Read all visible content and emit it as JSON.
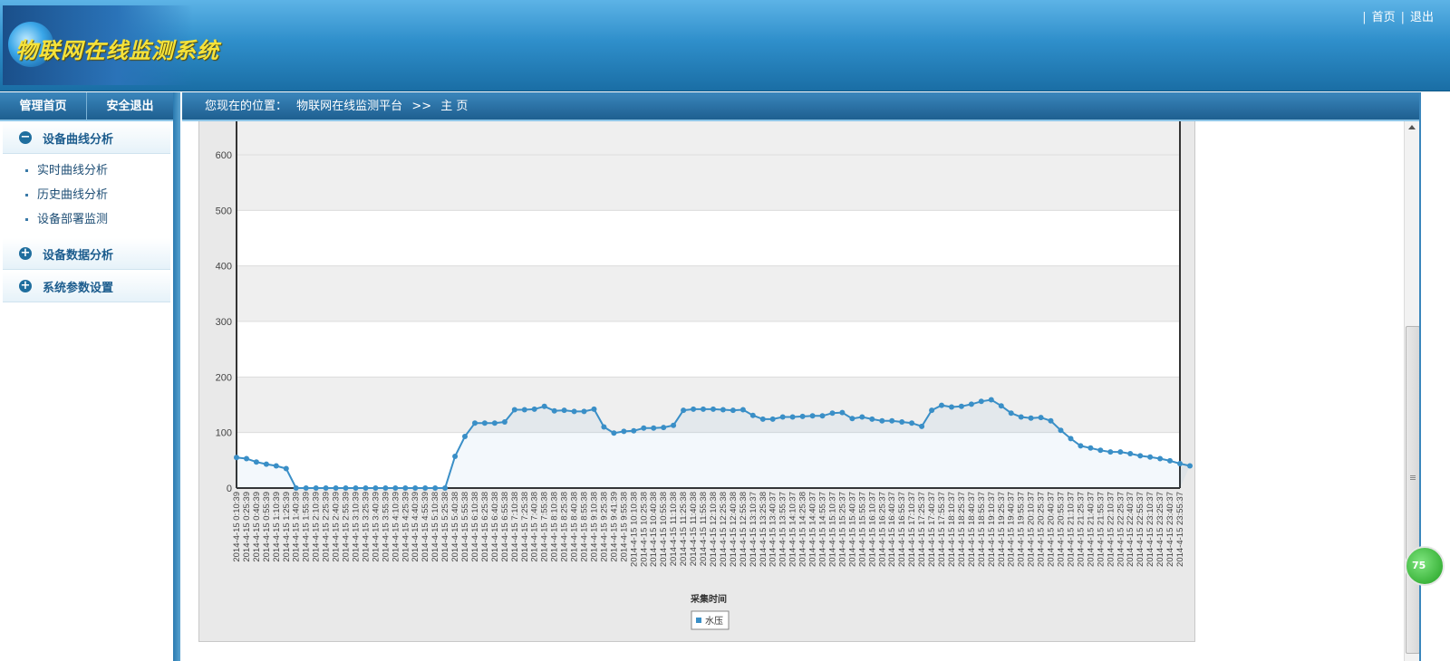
{
  "header": {
    "logo_text": "物联网在线监测系统",
    "links": [
      "首页",
      "退出"
    ]
  },
  "sidebar": {
    "tabs": [
      "管理首页",
      "安全退出"
    ],
    "groups": [
      {
        "label": "设备曲线分析",
        "icon": "minus-circle-icon",
        "expanded": true,
        "items": [
          "实时曲线分析",
          "历史曲线分析",
          "设备部署监测"
        ]
      },
      {
        "label": "设备数据分析",
        "icon": "plus-circle-icon",
        "expanded": false
      },
      {
        "label": "系统参数设置",
        "icon": "plus-circle-icon",
        "expanded": false
      }
    ]
  },
  "breadcrumb": {
    "prefix": "您现在的位置：",
    "path": [
      "物联网在线监测平台",
      ">>",
      "主 页"
    ]
  },
  "badge": {
    "text": "75"
  },
  "colors": {
    "accent": "#1f6e9e",
    "series": "#3a8fc7",
    "logo_text": "#f5e23a"
  },
  "chart_data": {
    "type": "line",
    "title": "",
    "xlabel": "采集时间",
    "ylabel": "",
    "ylim": [
      0,
      600
    ],
    "yticks": [
      0,
      100,
      200,
      300,
      400,
      500,
      600
    ],
    "grid": true,
    "legend_position": "bottom-center",
    "x": [
      "2014-4-15 0:10:39",
      "2014-4-15 0:25:39",
      "2014-4-15 0:40:39",
      "2014-4-15 0:55:39",
      "2014-4-15 1:10:39",
      "2014-4-15 1:25:39",
      "2014-4-15 1:40:39",
      "2014-4-15 1:55:39",
      "2014-4-15 2:10:39",
      "2014-4-15 2:25:39",
      "2014-4-15 2:40:39",
      "2014-4-15 2:55:39",
      "2014-4-15 3:10:39",
      "2014-4-15 3:25:39",
      "2014-4-15 3:40:39",
      "2014-4-15 3:55:39",
      "2014-4-15 4:10:39",
      "2014-4-15 4:25:39",
      "2014-4-15 4:40:39",
      "2014-4-15 4:55:39",
      "2014-4-15 5:10:38",
      "2014-4-15 5:25:38",
      "2014-4-15 5:40:38",
      "2014-4-15 5:55:38",
      "2014-4-15 6:10:38",
      "2014-4-15 6:25:38",
      "2014-4-15 6:40:38",
      "2014-4-15 6:55:38",
      "2014-4-15 7:10:38",
      "2014-4-15 7:25:38",
      "2014-4-15 7:40:38",
      "2014-4-15 7:55:38",
      "2014-4-15 8:10:38",
      "2014-4-15 8:25:38",
      "2014-4-15 8:40:38",
      "2014-4-15 8:55:38",
      "2014-4-15 9:10:38",
      "2014-4-15 9:25:38",
      "2014-4-15 9:41:39",
      "2014-4-15 9:55:38",
      "2014-4-15 10:10:38",
      "2014-4-15 10:25:38",
      "2014-4-15 10:40:38",
      "2014-4-15 10:55:38",
      "2014-4-15 11:10:38",
      "2014-4-15 11:25:38",
      "2014-4-15 11:40:38",
      "2014-4-15 11:55:38",
      "2014-4-15 12:10:38",
      "2014-4-15 12:25:38",
      "2014-4-15 12:40:38",
      "2014-4-15 12:55:38",
      "2014-4-15 13:10:37",
      "2014-4-15 13:25:38",
      "2014-4-15 13:40:37",
      "2014-4-15 13:55:37",
      "2014-4-15 14:10:37",
      "2014-4-15 14:25:38",
      "2014-4-15 14:40:37",
      "2014-4-15 14:55:37",
      "2014-4-15 15:10:37",
      "2014-4-15 15:25:37",
      "2014-4-15 15:40:37",
      "2014-4-15 15:55:37",
      "2014-4-15 16:10:37",
      "2014-4-15 16:25:37",
      "2014-4-15 16:40:37",
      "2014-4-15 16:55:37",
      "2014-4-15 17:10:37",
      "2014-4-15 17:25:37",
      "2014-4-15 17:40:37",
      "2014-4-15 17:55:37",
      "2014-4-15 18:10:37",
      "2014-4-15 18:25:37",
      "2014-4-15 18:40:37",
      "2014-4-15 18:55:37",
      "2014-4-15 19:10:37",
      "2014-4-15 19:25:37",
      "2014-4-15 19:40:37",
      "2014-4-15 19:55:37",
      "2014-4-15 20:10:37",
      "2014-4-15 20:25:37",
      "2014-4-15 20:40:37",
      "2014-4-15 20:55:37",
      "2014-4-15 21:10:37",
      "2014-4-15 21:25:37",
      "2014-4-15 21:40:37",
      "2014-4-15 21:55:37",
      "2014-4-15 22:10:37",
      "2014-4-15 22:25:37",
      "2014-4-15 22:40:37",
      "2014-4-15 22:55:37",
      "2014-4-15 23:10:37",
      "2014-4-15 23:25:37",
      "2014-4-15 23:40:37",
      "2014-4-15 23:55:37"
    ],
    "series": [
      {
        "name": "水压",
        "color": "#3a8fc7",
        "values": [
          55,
          53,
          47,
          43,
          40,
          35,
          0,
          0,
          0,
          0,
          0,
          0,
          0,
          0,
          0,
          0,
          0,
          0,
          0,
          0,
          0,
          0,
          57,
          93,
          117,
          117,
          117,
          119,
          141,
          141,
          142,
          147,
          139,
          140,
          138,
          138,
          142,
          110,
          99,
          102,
          103,
          108,
          108,
          109,
          113,
          140,
          142,
          142,
          142,
          141,
          140,
          141,
          131,
          124,
          124,
          128,
          128,
          129,
          130,
          130,
          135,
          136,
          125,
          128,
          124,
          121,
          121,
          119,
          117,
          111,
          140,
          149,
          146,
          147,
          151,
          156,
          159,
          148,
          135,
          128,
          126,
          127,
          121,
          104,
          89,
          76,
          72,
          68,
          65,
          65,
          62,
          58,
          56,
          53,
          49,
          44,
          40
        ]
      }
    ]
  }
}
